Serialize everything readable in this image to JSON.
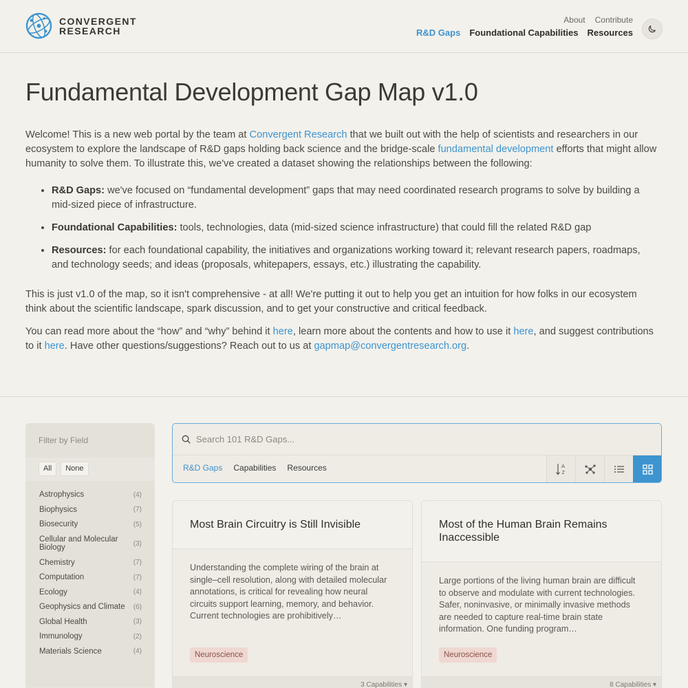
{
  "header": {
    "logo_line1": "CONVERGENT",
    "logo_line2": "RESEARCH",
    "util_nav": [
      "About",
      "Contribute"
    ],
    "main_nav": [
      "R&D Gaps",
      "Foundational Capabilities",
      "Resources"
    ],
    "active_nav": "R&D Gaps",
    "theme_icon": "moon-icon"
  },
  "intro": {
    "title": "Fundamental Development Gap Map v1.0",
    "p1_a": "Welcome! This is a new web portal by the team at ",
    "p1_link1": "Convergent Research",
    "p1_b": " that we built out with the help of scientists and researchers in our ecosystem to explore the landscape of R&D gaps holding back science and the bridge-scale ",
    "p1_link2": "fundamental development",
    "p1_c": " efforts that might allow humanity to solve them. To illustrate this, we've created a dataset showing the relationships between the following:",
    "bullets": [
      {
        "term": "R&D Gaps:",
        "text": " we've focused on “fundamental development” gaps that may need coordinated research programs to solve by building a mid-sized piece of infrastructure."
      },
      {
        "term": "Foundational Capabilities:",
        "text": " tools, technologies, data (mid-sized science infrastructure) that could fill the related R&D gap"
      },
      {
        "term": "Resources:",
        "text": " for each foundational capability, the initiatives and organizations working toward it; relevant research papers, roadmaps, and technology seeds; and ideas (proposals, whitepapers, essays, etc.) illustrating the capability."
      }
    ],
    "p2": "This is just v1.0 of the map, so it isn't comprehensive - at all! We're putting it out to help you get an intuition for how folks in our ecosystem think about the scientific landscape, spark discussion, and to get your constructive and critical feedback.",
    "p3_a": "You can read more about the “how” and “why” behind it ",
    "p3_link1": "here",
    "p3_b": ", learn more about the contents and how to use it ",
    "p3_link2": "here",
    "p3_c": ", and suggest contributions to it ",
    "p3_link3": "here",
    "p3_d": ". Have other questions/suggestions? Reach out to us at ",
    "p3_email": "gapmap@convergentresearch.org",
    "p3_e": "."
  },
  "sidebar": {
    "title": "Filter by Field",
    "all_label": "All",
    "none_label": "None",
    "fields": [
      {
        "name": "Astrophysics",
        "count": "(4)"
      },
      {
        "name": "Biophysics",
        "count": "(7)"
      },
      {
        "name": "Biosecurity",
        "count": "(5)"
      },
      {
        "name": "Cellular and Molecular Biology",
        "count": "(3)"
      },
      {
        "name": "Chemistry",
        "count": "(7)"
      },
      {
        "name": "Computation",
        "count": "(7)"
      },
      {
        "name": "Ecology",
        "count": "(4)"
      },
      {
        "name": "Geophysics and Climate",
        "count": "(6)"
      },
      {
        "name": "Global Health",
        "count": "(3)"
      },
      {
        "name": "Immunology",
        "count": "(2)"
      },
      {
        "name": "Materials Science",
        "count": "(4)"
      }
    ]
  },
  "search": {
    "placeholder": "Search 101 R&D Gaps...",
    "tabs": [
      "R&D Gaps",
      "Capabilities",
      "Resources"
    ],
    "active_tab": "R&D Gaps",
    "view_icons": [
      "sort-az-icon",
      "graph-view-icon",
      "list-view-icon",
      "grid-view-icon"
    ],
    "active_view": "grid-view-icon"
  },
  "cards": [
    {
      "title": "Most Brain Circuitry is Still Invisible",
      "description": "Understanding the complete wiring of the brain at single–cell resolution, along with detailed molecular annotations, is critical for revealing how neural circuits support learning, memory, and behavior. Current technologies are prohibitively…",
      "tag": "Neuroscience",
      "footer": "3 Capabilities ▾"
    },
    {
      "title": "Most of the Human Brain Remains Inaccessible",
      "description": "Large portions of the living human brain are difficult to observe and modulate with current technologies. Safer, noninvasive, or minimally invasive methods are needed to capture real-time brain state information. One funding program…",
      "tag": "Neuroscience",
      "footer": "8 Capabilities ▾"
    }
  ],
  "colors": {
    "accent": "#3d94cf",
    "background": "#f3f1ec",
    "tag_bg": "#efd8d1",
    "tag_text": "#8a5148"
  }
}
